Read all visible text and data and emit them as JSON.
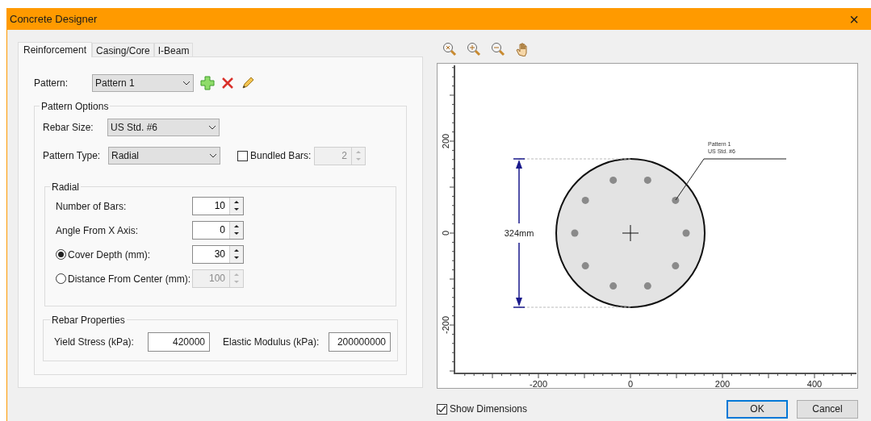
{
  "window": {
    "title": "Concrete Designer",
    "close": "×"
  },
  "tabs": [
    {
      "label": "Reinforcement",
      "selected": true
    },
    {
      "label": "Casing/Core",
      "selected": false
    },
    {
      "label": "I-Beam",
      "selected": false
    }
  ],
  "pattern": {
    "label": "Pattern:",
    "value": "Pattern 1"
  },
  "pattern_options": {
    "title": "Pattern Options",
    "rebar_size": {
      "label": "Rebar Size:",
      "value": "US Std. #6"
    },
    "pattern_type": {
      "label": "Pattern Type:",
      "value": "Radial"
    },
    "bundled_bars": {
      "label": "Bundled Bars:",
      "checked": false,
      "value": "2",
      "disabled": true
    }
  },
  "radial": {
    "title": "Radial",
    "fields": [
      {
        "kind": "plain",
        "label": "Number of Bars:",
        "value": "10",
        "disabled": false
      },
      {
        "kind": "plain",
        "label": "Angle From X Axis:",
        "value": "0",
        "disabled": false
      },
      {
        "kind": "radio",
        "label": "Cover Depth (mm):",
        "value": "30",
        "selected": true,
        "disabled": false
      },
      {
        "kind": "radio",
        "label": "Distance From Center (mm):",
        "value": "100",
        "selected": false,
        "disabled": true
      }
    ]
  },
  "rebar_properties": {
    "title": "Rebar Properties",
    "fields": [
      {
        "label": "Yield Stress (kPa):",
        "value": "420000"
      },
      {
        "label": "Elastic Modulus (kPa):",
        "value": "200000000"
      }
    ]
  },
  "viewer": {
    "x_ticks": [
      "-200",
      "0",
      "200",
      "400"
    ],
    "y_ticks": [
      "200",
      "0",
      "-200"
    ],
    "dimension": "324mm",
    "callout": [
      "Pattern 1",
      "US Std. #6"
    ]
  },
  "show_dimensions": {
    "label": "Show Dimensions",
    "checked": true
  },
  "buttons": [
    {
      "label": "OK",
      "default": true
    },
    {
      "label": "Cancel",
      "default": false
    }
  ]
}
